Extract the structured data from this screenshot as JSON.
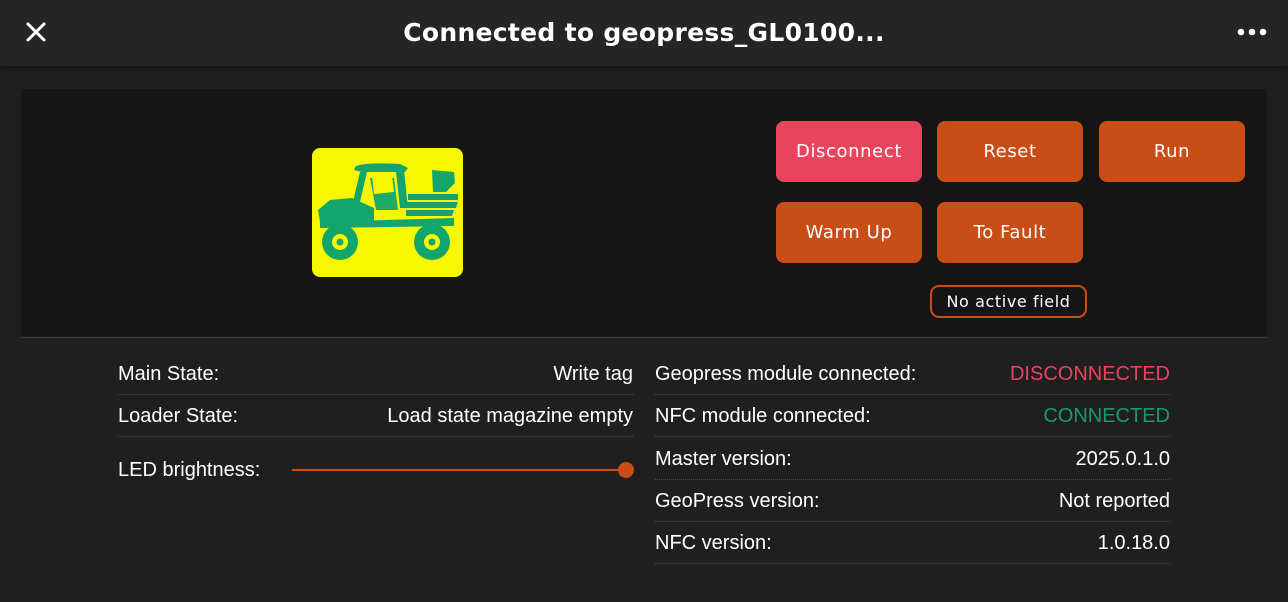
{
  "header": {
    "title": "Connected to geopress_GL0100...",
    "close_icon": "close-icon",
    "more_icon": "more-horizontal-icon"
  },
  "controls": {
    "vehicle_icon": "utility-vehicle-icon",
    "buttons": {
      "disconnect": "Disconnect",
      "reset": "Reset",
      "run": "Run",
      "warm_up": "Warm Up",
      "to_fault": "To Fault"
    },
    "field_status": "No active field"
  },
  "status": {
    "main_state_label": "Main State:",
    "main_state_value": "Write tag",
    "loader_state_label": "Loader State:",
    "loader_state_value": "Load state magazine empty",
    "led_brightness_label": "LED brightness:",
    "led_brightness_level": 1.0,
    "geopress_label": "Geopress module connected:",
    "geopress_value": "DISCONNECTED",
    "nfc_label": "NFC module connected:",
    "nfc_value": "CONNECTED",
    "master_version_label": "Master version:",
    "master_version_value": "2025.0.1.0",
    "geopress_version_label": "GeoPress version:",
    "geopress_version_value": "Not reported",
    "nfc_version_label": "NFC version:",
    "nfc_version_value": "1.0.18.0"
  },
  "colors": {
    "accent": "#c84d17",
    "danger": "#e9445e",
    "success": "#1a9a6a",
    "vehicle_bg": "#f7f700",
    "vehicle_fg": "#13a56e"
  }
}
